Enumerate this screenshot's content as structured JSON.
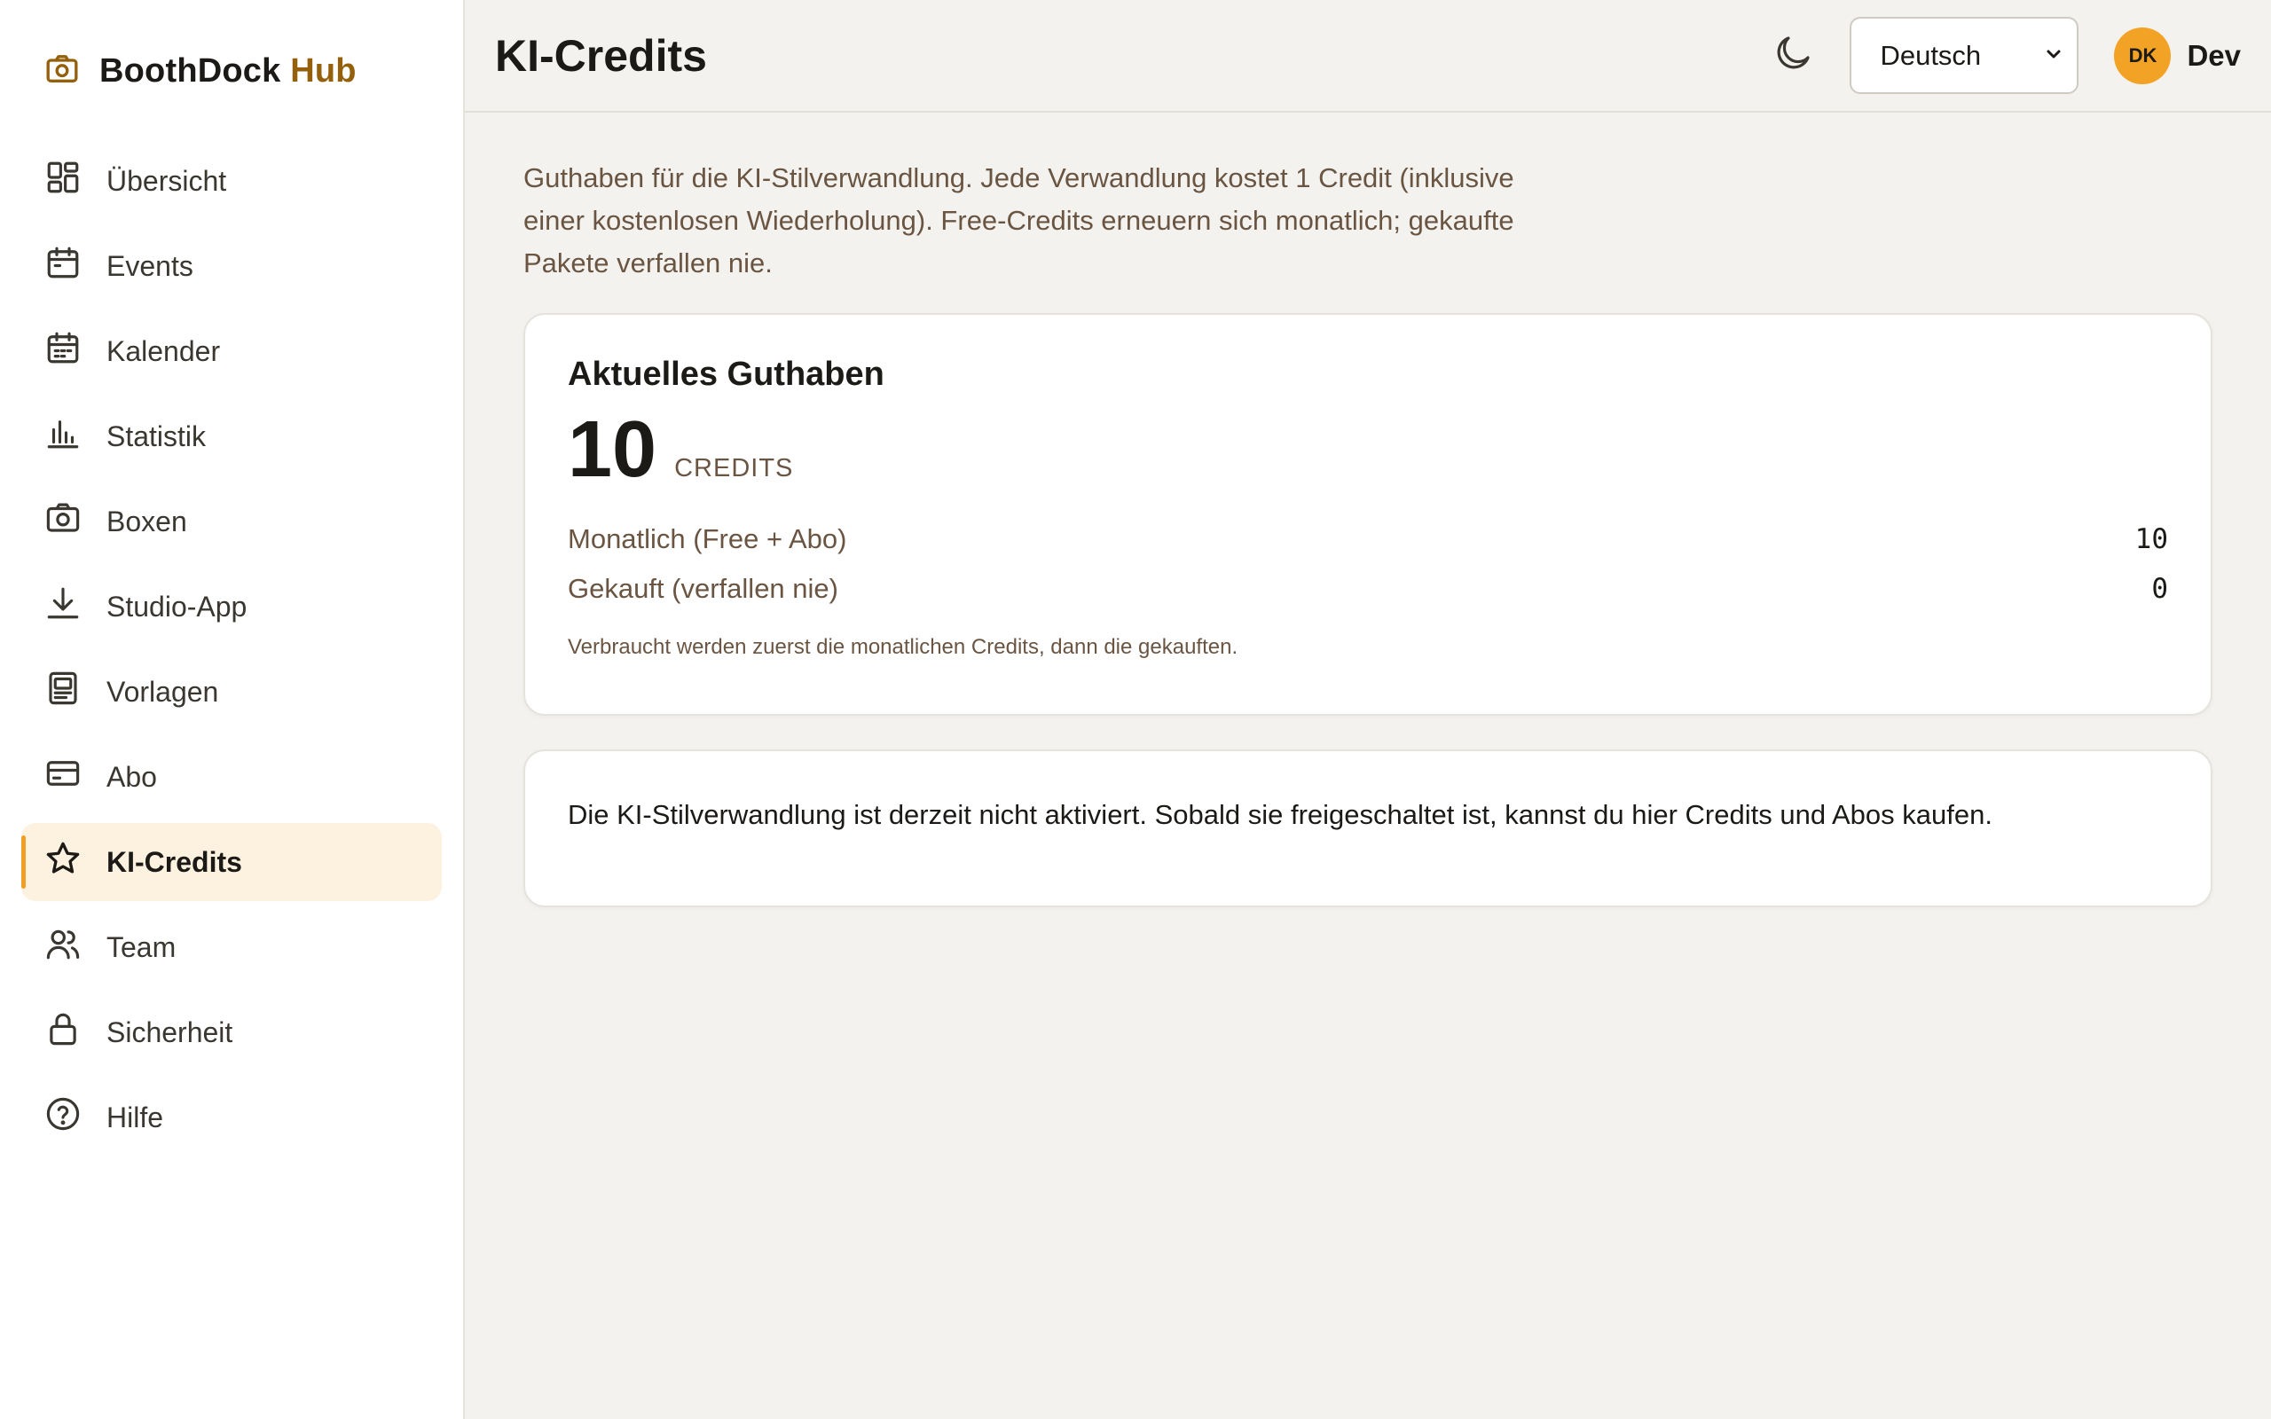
{
  "brand": {
    "name": "BoothDock",
    "accent": "Hub",
    "accent_color": "#94600c",
    "icon": "camera-icon"
  },
  "sidebar": {
    "items": [
      {
        "label": "Übersicht",
        "icon": "dashboard-grid-icon"
      },
      {
        "label": "Events",
        "icon": "calendar-icon"
      },
      {
        "label": "Kalender",
        "icon": "calendar-grid-icon"
      },
      {
        "label": "Statistik",
        "icon": "bar-chart-icon"
      },
      {
        "label": "Boxen",
        "icon": "camera-icon"
      },
      {
        "label": "Studio-App",
        "icon": "download-icon"
      },
      {
        "label": "Vorlagen",
        "icon": "template-icon"
      },
      {
        "label": "Abo",
        "icon": "credit-card-icon"
      },
      {
        "label": "KI-Credits",
        "icon": "sparkle-star-icon",
        "active": true
      },
      {
        "label": "Team",
        "icon": "users-icon"
      },
      {
        "label": "Sicherheit",
        "icon": "lock-icon"
      },
      {
        "label": "Hilfe",
        "icon": "help-circle-icon"
      }
    ],
    "active_color": "#fdf1df",
    "active_indicator_color": "#f0a026"
  },
  "header": {
    "title": "KI-Credits",
    "theme_icon": "moon-icon",
    "language": {
      "selected": "Deutsch"
    },
    "user": {
      "initials": "DK",
      "name": "Dev",
      "avatar_color": "#f2a224"
    }
  },
  "main": {
    "intro": "Guthaben für die KI-Stilverwandlung. Jede Verwandlung kostet 1 Credit (inklusive einer kostenlosen Wiederholung). Free-Credits erneuern sich monatlich; gekaufte Pakete verfallen nie.",
    "balance": {
      "title": "Aktuelles Guthaben",
      "value": "10",
      "unit": "CREDITS",
      "monthly_label": "Monatlich (Free + Abo)",
      "monthly_value": "10",
      "purchased_label": "Gekauft (verfallen nie)",
      "purchased_value": "0",
      "note": "Verbraucht werden zuerst die monatlichen Credits, dann die gekauften."
    },
    "info": "Die KI-Stilverwandlung ist derzeit nicht aktiviert. Sobald sie freigeschaltet ist, kannst du hier Credits und Abos kaufen."
  }
}
